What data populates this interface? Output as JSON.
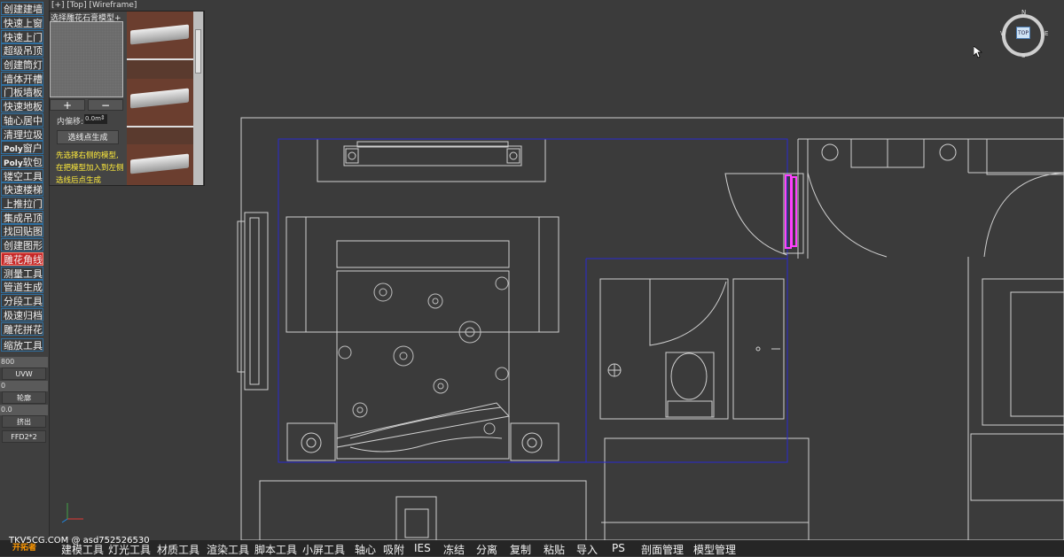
{
  "viewport": {
    "label": "[+] [Top] [Wireframe]"
  },
  "toolbar": {
    "buttons": [
      "创建建墙",
      "快速上窗",
      "快速上门",
      "超级吊顶",
      "创建筒灯",
      "墙体开槽",
      "门板墙板",
      "快速地板",
      "轴心居中",
      "清理垃圾",
      "窗户",
      "软包",
      "镂空工具",
      "快速楼梯",
      "上推拉门",
      "集成吊顶",
      "找回贴图",
      "创建图形",
      "雕花角线",
      "测量工具",
      "管道生成",
      "分段工具",
      "极速归档",
      "雕花拼花",
      "缩放工具"
    ],
    "poly_prefix": "Poly",
    "field1": "800",
    "uvw": "UVW",
    "field2": "0",
    "contour": "轮廓",
    "field3": "0.0",
    "extrude": "挤出",
    "ffd": "FFD2*2"
  },
  "panel": {
    "title": "选择雕花石膏模型+",
    "plus": "+",
    "minus": "−",
    "offset_label": "内偏移:",
    "offset_value": "0.0m",
    "spin": "⇕",
    "generate": "选线点生成",
    "hint1": "先选择右侧的模型,",
    "hint2": "在把模型加入到左侧",
    "hint3": "选线后点生成"
  },
  "viewcube": {
    "top": "TOP",
    "n": "N",
    "s": "S",
    "w": "W",
    "e": "E"
  },
  "watermark": "TKV5CG.COM @ asd752526530",
  "bottom_logo": "开拓者",
  "bottombar": [
    "建模工具",
    "灯光工具",
    "材质工具",
    "渲染工具",
    "脚本工具",
    "小屏工具",
    "轴心",
    "吸附",
    "IES",
    "冻结",
    "分离",
    "复制",
    "粘贴",
    "导入",
    "PS",
    "剖面管理",
    "模型管理"
  ],
  "colors": {
    "selection_blue": "#2a2ad0",
    "magenta": "#ff40ff",
    "active_red": "#c62828",
    "hint_yellow": "#ffeb3b"
  }
}
